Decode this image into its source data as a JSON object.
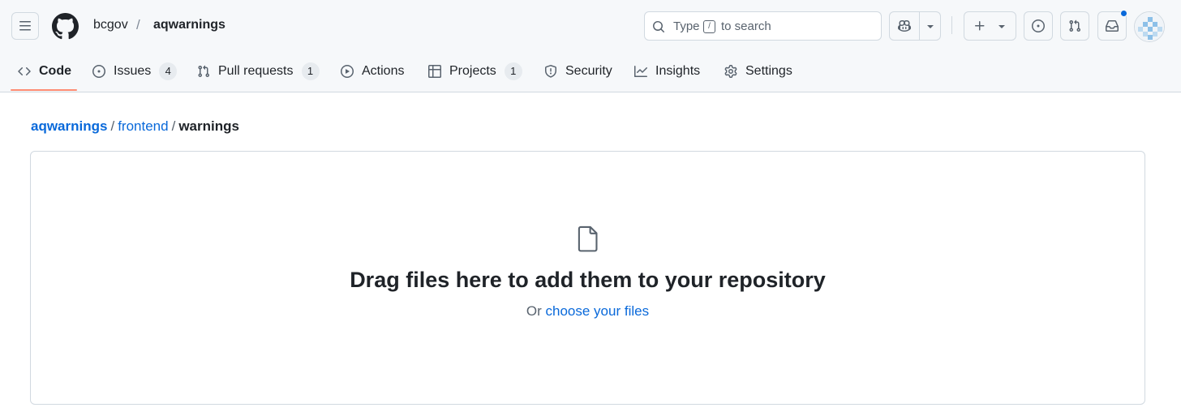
{
  "header": {
    "owner": "bcgov",
    "separator": "/",
    "repo": "aqwarnings",
    "search": {
      "prefix": "Type",
      "key": "/",
      "suffix": "to search"
    },
    "notification_color": "#0969da"
  },
  "tabs": [
    {
      "label": "Code",
      "icon": "code-icon",
      "selected": true
    },
    {
      "label": "Issues",
      "icon": "issue-opened-icon",
      "count": "4"
    },
    {
      "label": "Pull requests",
      "icon": "git-pull-request-icon",
      "count": "1"
    },
    {
      "label": "Actions",
      "icon": "play-icon"
    },
    {
      "label": "Projects",
      "icon": "table-icon",
      "count": "1"
    },
    {
      "label": "Security",
      "icon": "shield-icon"
    },
    {
      "label": "Insights",
      "icon": "graph-icon"
    },
    {
      "label": "Settings",
      "icon": "gear-icon"
    }
  ],
  "path": {
    "root": "aqwarnings",
    "sep": "/",
    "folder": "frontend",
    "current": "warnings"
  },
  "dropzone": {
    "icon": "file-icon",
    "title": "Drag files here to add them to your repository",
    "prefix": "Or",
    "link": "choose your files"
  },
  "colors": {
    "accent": "#0969da",
    "selected_tab_underline": "#fd8c73"
  }
}
